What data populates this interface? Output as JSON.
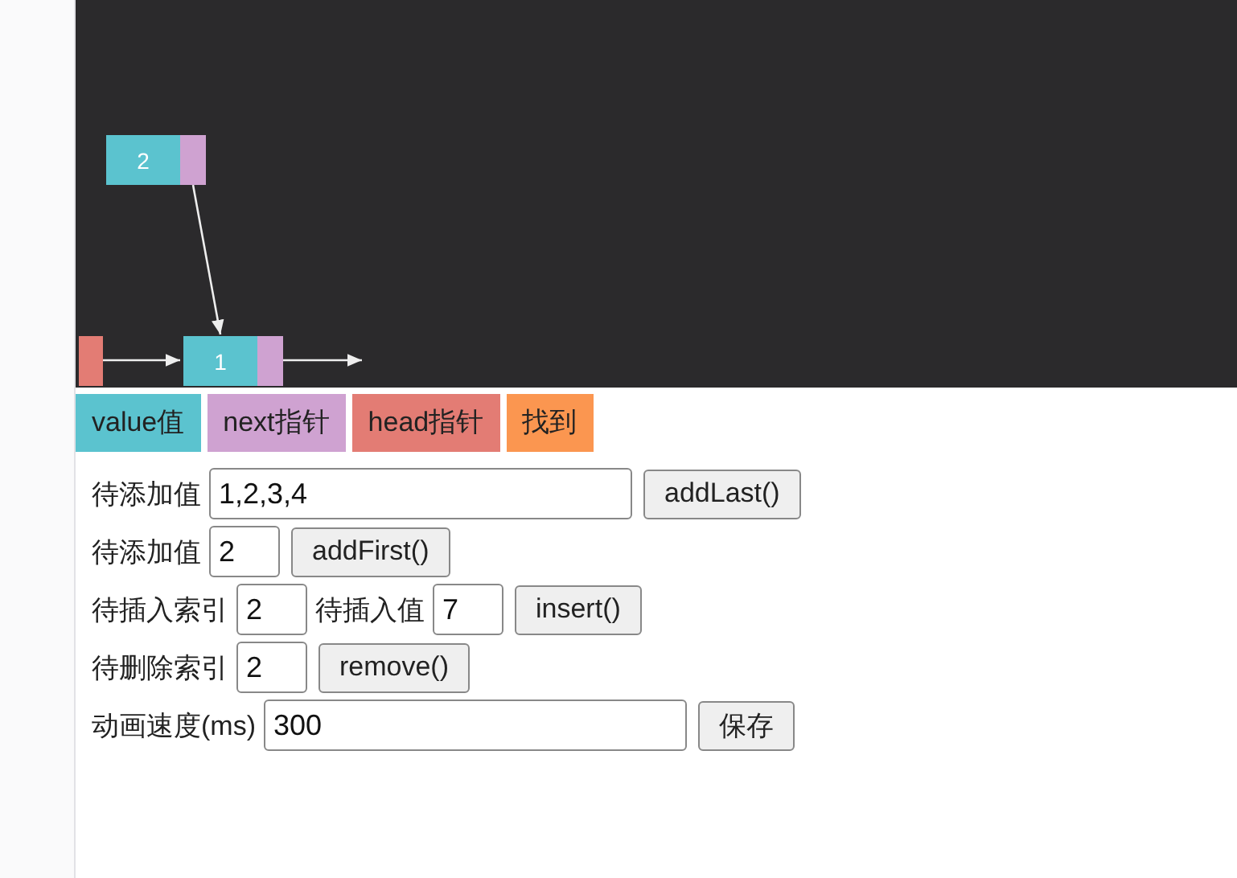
{
  "canvas": {
    "head": {
      "kind": "head"
    },
    "nodes": [
      {
        "value": "2"
      },
      {
        "value": "1"
      }
    ]
  },
  "legend": [
    {
      "label": "value值",
      "color": "#5bc3cf"
    },
    {
      "label": "next指针",
      "color": "#cfa2d1"
    },
    {
      "label": "head指针",
      "color": "#e37c74"
    },
    {
      "label": "找到",
      "color": "#fb9650"
    }
  ],
  "form": [
    {
      "items": [
        {
          "kind": "label",
          "text": "待添加值"
        },
        {
          "kind": "long-field",
          "value": "1,2,3,4"
        },
        {
          "kind": "button",
          "text": "addLast()"
        }
      ]
    },
    {
      "items": [
        {
          "kind": "label",
          "text": "待添加值"
        },
        {
          "kind": "short-field",
          "value": "2"
        },
        {
          "kind": "button",
          "text": "addFirst()"
        }
      ]
    },
    {
      "items": [
        {
          "kind": "label",
          "text": "待插入索引"
        },
        {
          "kind": "short-field",
          "value": "2"
        },
        {
          "kind": "label",
          "text": "待插入值"
        },
        {
          "kind": "short-field",
          "value": "7"
        },
        {
          "kind": "button",
          "text": "insert()"
        }
      ]
    },
    {
      "items": [
        {
          "kind": "label",
          "text": "待删除索引"
        },
        {
          "kind": "short-field",
          "value": "2"
        },
        {
          "kind": "button",
          "text": "remove()"
        }
      ]
    },
    {
      "items": [
        {
          "kind": "label",
          "text": "动画速度(ms)"
        },
        {
          "kind": "long-field",
          "value": "300"
        },
        {
          "kind": "button",
          "text": "保存"
        }
      ]
    }
  ]
}
